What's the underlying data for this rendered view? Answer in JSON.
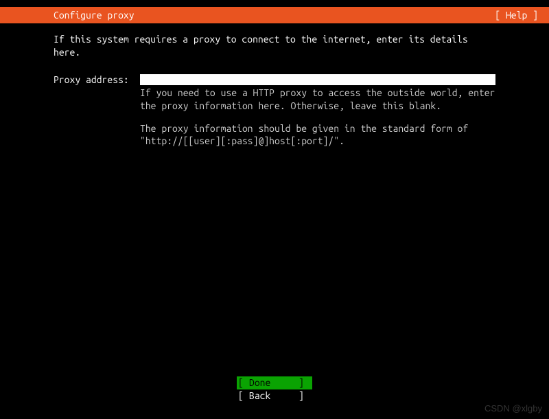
{
  "header": {
    "title": "Configure proxy",
    "help": "[ Help ]"
  },
  "intro": "If this system requires a proxy to connect to the internet, enter its details here.",
  "form": {
    "proxy_label": "Proxy address:",
    "proxy_value": "",
    "help1": "If you need to use a HTTP proxy to access the outside world, enter the proxy information here. Otherwise, leave this blank.",
    "help2": "The proxy information should be given in the standard form of \"http://[[user][:pass]@]host[:port]/\"."
  },
  "footer": {
    "done": "Done",
    "back": "Back"
  },
  "watermark": "CSDN @xlgby"
}
